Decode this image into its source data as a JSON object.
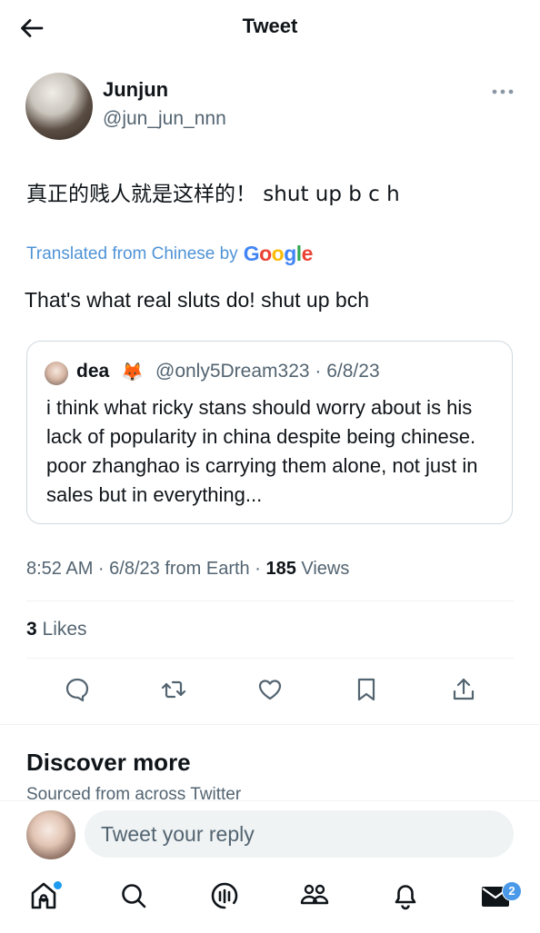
{
  "header": {
    "title": "Tweet",
    "back_icon": "arrow-left-icon"
  },
  "tweet": {
    "author_name": "Junjun",
    "author_handle": "@jun_jun_nnn",
    "text": "真正的贱人就是这样的！ shut up  b c h",
    "translated_prefix": "Translated from Chinese by",
    "translated_by": "Google",
    "translation": "That's what real sluts do! shut up bch",
    "quote": {
      "name": "dea",
      "emoji": "🦊",
      "handle_date": "@only5Dream323 · 6/8/23",
      "text": "i think what ricky stans should worry about is his lack of popularity in china despite being chinese. poor zhanghao is carrying them alone, not just in sales but in everything..."
    },
    "time_date": "8:52 AM · 6/8/23 from Earth · ",
    "views_count": "185",
    "views_label": " Views",
    "likes_count": "3",
    "likes_label": " Likes"
  },
  "discover": {
    "title": "Discover more",
    "subtitle": "Sourced from across Twitter"
  },
  "reply": {
    "placeholder": "Tweet your reply"
  },
  "nav": {
    "messages_badge": "2"
  },
  "colors": {
    "google_blue": "#4285F4",
    "google_red": "#EA4335",
    "google_yellow": "#FBBC05",
    "google_green": "#34A853",
    "link_blue": "#4f93d6",
    "badge_blue": "#4a99e9"
  }
}
